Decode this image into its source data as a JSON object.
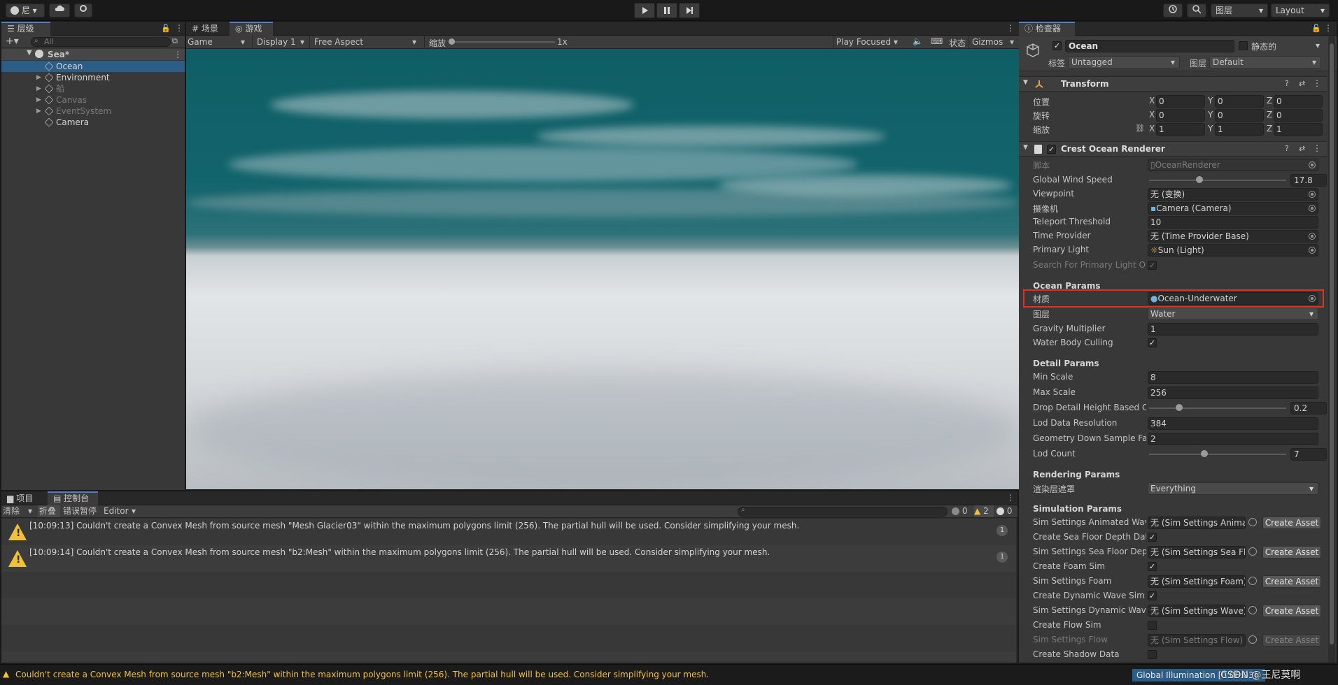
{
  "toolbar": {
    "account_label": "尼",
    "layers_label": "图层",
    "layout_label": "Layout"
  },
  "hierarchy": {
    "tab_label": "层级",
    "search_placeholder": "All",
    "scene_name": "Sea*",
    "items": [
      {
        "label": "Ocean",
        "selected": true,
        "dim": false
      },
      {
        "label": "Environment",
        "selected": false,
        "dim": false
      },
      {
        "label": "船",
        "selected": false,
        "dim": true
      },
      {
        "label": "Canvas",
        "selected": false,
        "dim": true
      },
      {
        "label": "EventSystem",
        "selected": false,
        "dim": true
      },
      {
        "label": "Camera",
        "selected": false,
        "dim": false
      }
    ]
  },
  "scene_tabs": {
    "scene_label": "场景",
    "game_label": "游戏"
  },
  "game_toolbar": {
    "mode": "Game",
    "display": "Display 1",
    "aspect": "Free Aspect",
    "scale_label": "缩放",
    "scale_value": "1x",
    "play_focused": "Play Focused",
    "stats_label": "状态",
    "gizmos_label": "Gizmos"
  },
  "inspector": {
    "tab_label": "检查器",
    "object_name": "Ocean",
    "static_label": "静态的",
    "tag_label": "标签",
    "tag_value": "Untagged",
    "layer_label": "图层",
    "layer_value": "Default",
    "transform": {
      "title": "Transform",
      "rows": [
        {
          "label": "位置",
          "x": "0",
          "y": "0",
          "z": "0"
        },
        {
          "label": "旋转",
          "x": "0",
          "y": "0",
          "z": "0"
        },
        {
          "label": "缩放",
          "x": "1",
          "y": "1",
          "z": "1"
        }
      ]
    },
    "component_title": "Crest Ocean Renderer",
    "script_label": "脚本",
    "script_value": "OceanRenderer",
    "global_wind_speed": {
      "label": "Global Wind Speed",
      "value": "17.8",
      "fraction": 0.35
    },
    "viewpoint": {
      "label": "Viewpoint",
      "value": "无 (变换)"
    },
    "camera": {
      "label": "摄像机",
      "value": "Camera (Camera)"
    },
    "teleport_threshold": {
      "label": "Teleport Threshold",
      "value": "10"
    },
    "time_provider": {
      "label": "Time Provider",
      "value": "无 (Time Provider Base)"
    },
    "primary_light": {
      "label": "Primary Light",
      "value": "Sun (Light)"
    },
    "search_primary_light": {
      "label": "Search For Primary Light Or"
    },
    "ocean_params_title": "Ocean Params",
    "material": {
      "label": "材质",
      "value": "Ocean-Underwater"
    },
    "layer": {
      "label": "图层",
      "value": "Water"
    },
    "gravity_multiplier": {
      "label": "Gravity Multiplier",
      "value": "1"
    },
    "water_body_culling": {
      "label": "Water Body Culling"
    },
    "detail_params_title": "Detail Params",
    "min_scale": {
      "label": "Min Scale",
      "value": "8"
    },
    "max_scale": {
      "label": "Max Scale",
      "value": "256"
    },
    "drop_detail": {
      "label": "Drop Detail Height Based C",
      "value": "0.2",
      "fraction": 0.2
    },
    "lod_data_resolution": {
      "label": "Lod Data Resolution",
      "value": "384"
    },
    "geometry_down_sample": {
      "label": "Geometry Down Sample Fac",
      "value": "2"
    },
    "lod_count": {
      "label": "Lod Count",
      "value": "7",
      "fraction": 0.39
    },
    "rendering_params_title": "Rendering Params",
    "rendering_layer_mask": {
      "label": "渲染层遮罩",
      "value": "Everything"
    },
    "simulation_params_title": "Simulation Params",
    "create_asset_label": "Create Asset",
    "sim_rows": [
      {
        "label": "Sim Settings Animated Wave",
        "value": "无 (Sim Settings Animat",
        "dim": false
      },
      {
        "label": "Create Sea Floor Depth Dat",
        "checked": true
      },
      {
        "label": "Sim Settings Sea Floor Dept",
        "value": "无 (Sim Settings Sea Flo",
        "dim": false
      },
      {
        "label": "Create Foam Sim",
        "checked": true
      },
      {
        "label": "Sim Settings Foam",
        "value": "无 (Sim Settings Foam)",
        "dim": false
      },
      {
        "label": "Create Dynamic Wave Sim",
        "checked": true
      },
      {
        "label": "Sim Settings Dynamic Wave",
        "value": "无 (Sim Settings Wave)",
        "dim": false
      },
      {
        "label": "Create Flow Sim",
        "checked": false
      },
      {
        "label": "Sim Settings Flow",
        "value": "无 (Sim Settings Flow)",
        "dim": true
      },
      {
        "label": "Create Shadow Data",
        "checked": false
      }
    ]
  },
  "bottom_tabs": {
    "project_label": "项目",
    "console_label": "控制台"
  },
  "console": {
    "clear_label": "清除",
    "collapse_label": "折叠",
    "error_pause_label": "错误暂停",
    "editor_label": "Editor",
    "info_count": "0",
    "warning_count": "2",
    "error_count": "0",
    "entries": [
      {
        "text": "[10:09:13] Couldn't create a Convex Mesh from source mesh \"Mesh Glacier03\" within the maximum polygons limit (256). The partial hull will be used. Consider simplifying your mesh.",
        "count": "1"
      },
      {
        "text": "[10:09:14] Couldn't create a Convex Mesh from source mesh \"b2:Mesh\" within the maximum polygons limit (256). The partial hull will be used. Consider simplifying your mesh.",
        "count": "1"
      }
    ]
  },
  "status_bar": {
    "message": "Couldn't create a Convex Mesh from source mesh \"b2:Mesh\" within the maximum polygons limit (256). The partial hull will be used. Consider simplifying your mesh.",
    "global_illumination": "Global Illumination [0:06:03]",
    "watermark": "CSDN @王尼莫啊"
  },
  "colors": {
    "selection": "#2c5d87",
    "highlight_box": "#e03222",
    "warning": "#f0c23a",
    "sky": "#0f5e66"
  }
}
